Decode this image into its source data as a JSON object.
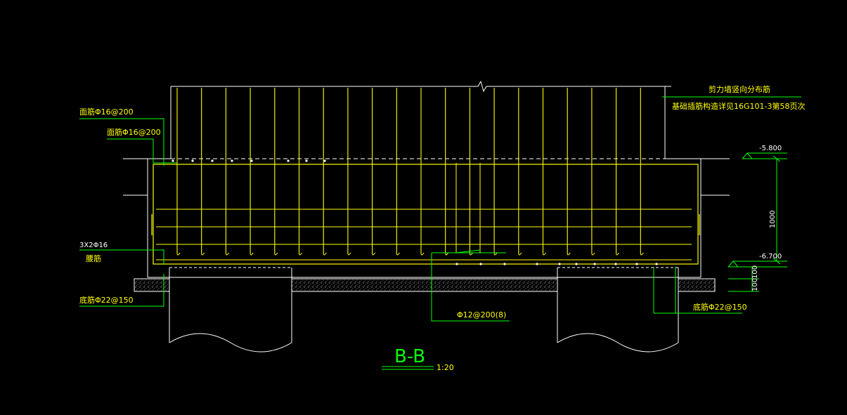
{
  "drawing": {
    "colors": {
      "background": "#000000",
      "concrete": "#ffffff",
      "rebar": "#ffff00",
      "leader": "#00ff00",
      "cushion": "#cccccc"
    },
    "labels": {
      "top_bar_1": "面筋Φ16@200",
      "top_bar_2": "面筋Φ16@200",
      "wall_bar": "剪力墙竖向分布筋",
      "wall_anchor": "基础插筋构造详见16G101-3第58页次",
      "waist_bar_count": "3X2Φ16",
      "waist_bar_name": "腰筋",
      "bottom_bar_left": "底筋Φ22@150",
      "stirrup": "Φ12@200(8)",
      "bottom_bar_right": "底筋Φ22@150"
    },
    "elevations": {
      "top": "-5.800",
      "bottom": "-6.700"
    },
    "dimensions": {
      "depth": "1000",
      "cushion_1": "100",
      "cushion_2": "100"
    },
    "section": {
      "title": "B-B",
      "scale": "1:20"
    }
  }
}
